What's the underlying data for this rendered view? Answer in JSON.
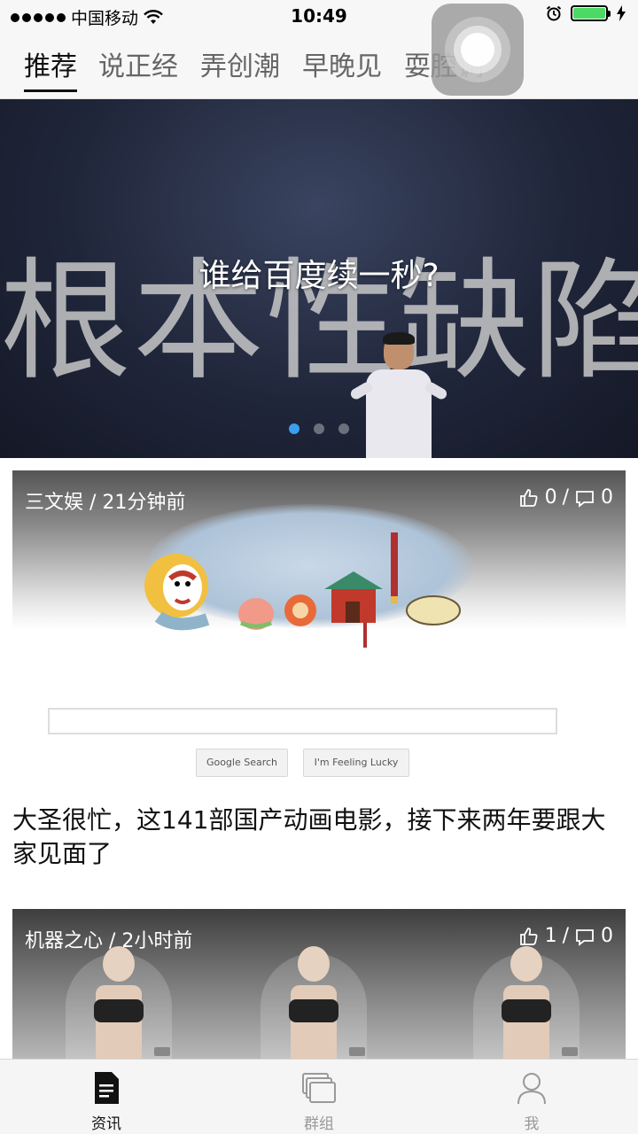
{
  "status_bar": {
    "carrier": "中国移动",
    "time": "10:49"
  },
  "top_tabs": [
    {
      "label": "推荐",
      "active": true
    },
    {
      "label": "说正经",
      "active": false
    },
    {
      "label": "弄创潮",
      "active": false
    },
    {
      "label": "早晚见",
      "active": false
    },
    {
      "label": "耍腔调",
      "active": false
    }
  ],
  "hero": {
    "title": "谁给百度续一秒?",
    "background_text": "根本性缺陷",
    "page_count": 3,
    "active_index": 0
  },
  "articles": [
    {
      "source": "三文娱",
      "time": "21分钟前",
      "meta": "三文娱 / 21分钟前",
      "likes": "0",
      "comments": "0",
      "title": "大圣很忙，这141部国产动画电影，接下来两年要跟大家见面了",
      "image": {
        "google_search_button": "Google Search",
        "lucky_button": "I'm Feeling Lucky"
      }
    },
    {
      "source": "机器之心",
      "time": "2小时前",
      "meta": "机器之心 / 2小时前",
      "likes": "1",
      "comments": "0",
      "image": {
        "tags": [
          "1027",
          "1028",
          "1029"
        ]
      }
    }
  ],
  "bottom_nav": [
    {
      "label": "资讯",
      "icon": "document-icon",
      "active": true
    },
    {
      "label": "群组",
      "icon": "stack-icon",
      "active": false
    },
    {
      "label": "我",
      "icon": "person-icon",
      "active": false
    }
  ],
  "colors": {
    "accent": "#3a9ff0",
    "battery": "#4cd964"
  }
}
